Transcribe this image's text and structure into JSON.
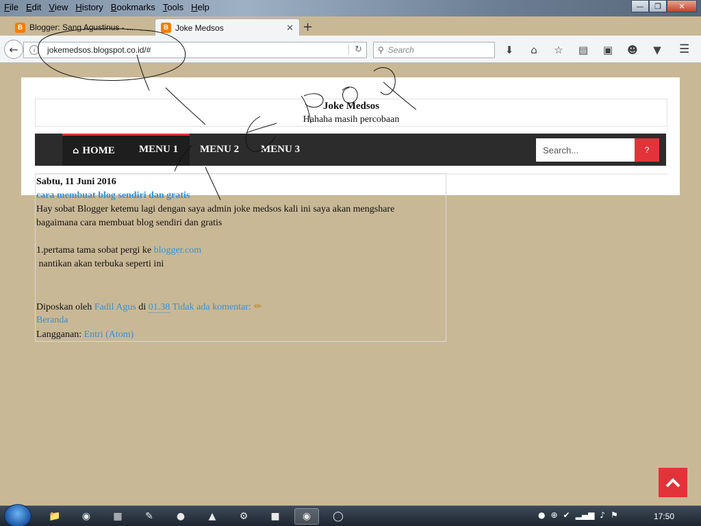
{
  "browser": {
    "menu": [
      "File",
      "Edit",
      "View",
      "History",
      "Bookmarks",
      "Tools",
      "Help"
    ],
    "tabs": [
      {
        "title": "Blogger: Sang Agustinus - ...",
        "active": false
      },
      {
        "title": "Joke Medsos",
        "active": true
      }
    ],
    "url": "jokemedsos.blogspot.co.id/#",
    "search_placeholder": "Search",
    "icons": [
      "download-icon",
      "home-icon",
      "bookmark-star-icon",
      "reading-list-icon",
      "screenshot-icon",
      "emoji-icon",
      "pocket-icon"
    ]
  },
  "blog": {
    "title": "Joke Medsos",
    "description": "Hahaha masih percobaan",
    "nav": [
      "HOME",
      "MENU 1",
      "MENU 2",
      "MENU 3"
    ],
    "search_placeholder": "Search...",
    "search_button": "?"
  },
  "post": {
    "date": "Sabtu, 11 Juni 2016",
    "title": "cara membuat blog sendiri dan gratis",
    "body_1": "Hay sobat Blogger ketemu lagi dengan saya admin joke medsos kali ini saya akan mengshare",
    "body_2": "bagaimana cara membuat blog sendiri dan gratis",
    "step_prefix": "1.pertama tama sobat pergi ke ",
    "step_link": "blogger.com",
    "step_2": " nantikan akan terbuka seperti ini",
    "posted_by": "Diposkan oleh ",
    "author": "Fadil Agus",
    "at": " di ",
    "time": "01.38",
    "comments": "Tidak ada komentar:",
    "home_link": "Beranda",
    "subscribe_label": "Langganan: ",
    "subscribe_link": "Entri (Atom)"
  },
  "taskbar": {
    "clock": "17:50"
  },
  "colors": {
    "page_bg": "#c9b896",
    "nav_bg": "#2c2c2c",
    "accent": "#e3333a",
    "link": "#3b8fd0"
  }
}
